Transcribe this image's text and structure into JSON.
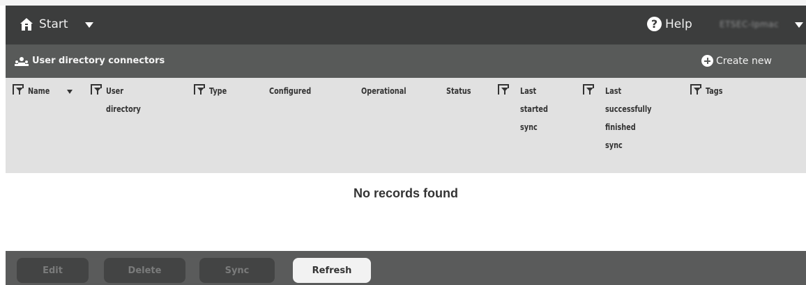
{
  "topbar": {
    "home_icon": "home-icon",
    "start_label": "Start",
    "help_icon": "question-circle-icon",
    "help_label": "Help",
    "user_name": "ETSEC-Ipmac"
  },
  "section": {
    "icon": "users-icon",
    "title": "User directory connectors",
    "create_icon": "plus-circle-icon",
    "create_label": "Create new"
  },
  "table": {
    "columns": [
      {
        "label": "Name",
        "filter": true,
        "sort": "desc"
      },
      {
        "label": "User\ndirectory",
        "filter": true
      },
      {
        "label": "Type",
        "filter": true
      },
      {
        "label": "Configured",
        "filter": false
      },
      {
        "label": "Operational",
        "filter": false
      },
      {
        "label": "Status",
        "filter": false
      },
      {
        "label": "Last\nstarted\nsync",
        "filter": true
      },
      {
        "label": "Last\nsuccessfully\nfinished\nsync",
        "filter": true
      },
      {
        "label": "Tags",
        "filter": true
      }
    ],
    "empty_message": "No records found"
  },
  "actions": {
    "edit": "Edit",
    "delete": "Delete",
    "sync": "Sync",
    "refresh": "Refresh"
  },
  "colors": {
    "topbar_bg": "#3c3d3d",
    "section_bg": "#585a59",
    "header_bg": "#e1e1e1",
    "bottom_bg": "#5a5b5b"
  }
}
